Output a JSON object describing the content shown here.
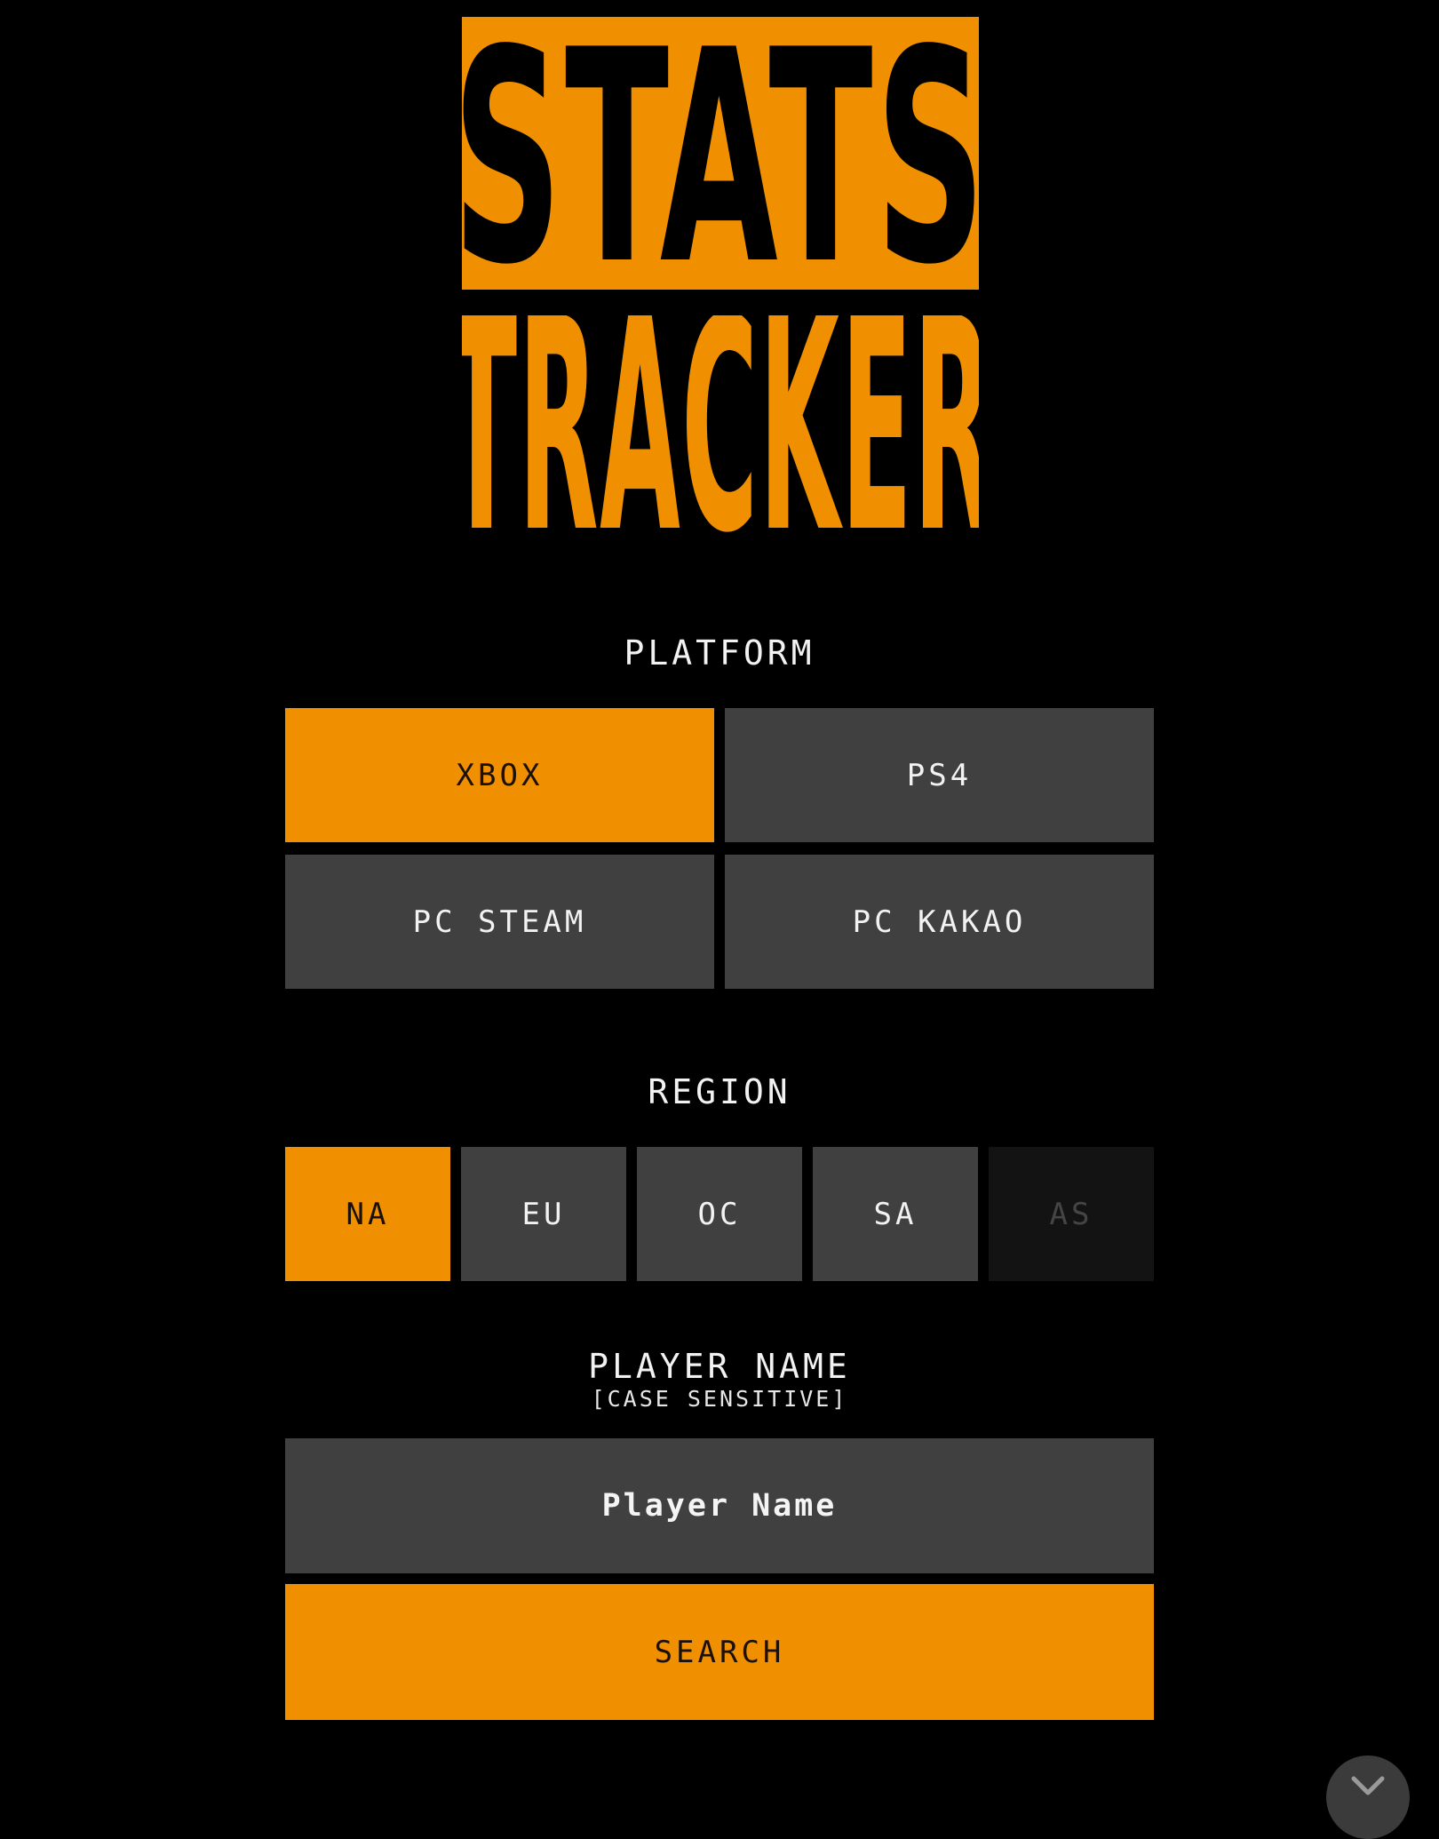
{
  "logo": {
    "line1": "STATS",
    "line2": "TRACKER"
  },
  "colors": {
    "accent": "#f09000",
    "button_bg": "#404040",
    "disabled_bg": "#131313",
    "background": "#000000"
  },
  "platform": {
    "label": "PLATFORM",
    "selected": "XBOX",
    "options": [
      {
        "label": "XBOX",
        "state": "active"
      },
      {
        "label": "PS4",
        "state": "normal"
      },
      {
        "label": "PC STEAM",
        "state": "normal"
      },
      {
        "label": "PC KAKAO",
        "state": "normal"
      }
    ]
  },
  "region": {
    "label": "REGION",
    "selected": "NA",
    "options": [
      {
        "label": "NA",
        "state": "active"
      },
      {
        "label": "EU",
        "state": "normal"
      },
      {
        "label": "OC",
        "state": "normal"
      },
      {
        "label": "SA",
        "state": "normal"
      },
      {
        "label": "AS",
        "state": "disabled"
      }
    ]
  },
  "player": {
    "label": "PLAYER NAME",
    "sublabel": "[CASE SENSITIVE]",
    "value": "",
    "placeholder": "Player Name"
  },
  "search": {
    "label": "SEARCH"
  },
  "fab": {
    "icon": "expand-chevron-icon"
  }
}
